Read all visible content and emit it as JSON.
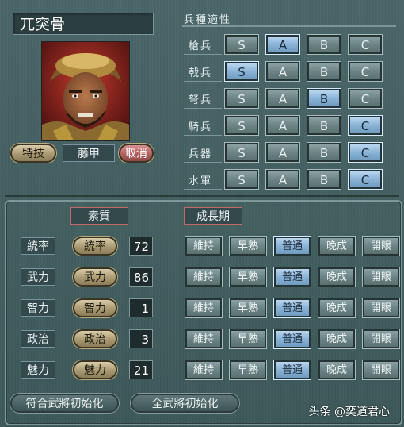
{
  "general": {
    "name": "兀突骨",
    "tech_label": "特技",
    "tech_value": "藤甲",
    "cancel_label": "取消"
  },
  "aptitude": {
    "title": "兵種適性",
    "grades": [
      "S",
      "A",
      "B",
      "C"
    ],
    "rows": [
      {
        "label": "槍兵",
        "selected": "A"
      },
      {
        "label": "戟兵",
        "selected": "S"
      },
      {
        "label": "弩兵",
        "selected": "B"
      },
      {
        "label": "騎兵",
        "selected": "C"
      },
      {
        "label": "兵器",
        "selected": "C"
      },
      {
        "label": "水軍",
        "selected": "C"
      }
    ]
  },
  "stats": {
    "quality_header": "素質",
    "growth_header": "成長期",
    "growth_options": [
      "維持",
      "早熟",
      "普通",
      "晚成",
      "開眼"
    ],
    "rows": [
      {
        "label": "統率",
        "button": "統率",
        "value": "72",
        "growth": "普通"
      },
      {
        "label": "武力",
        "button": "武力",
        "value": "86",
        "growth": "普通"
      },
      {
        "label": "智力",
        "button": "智力",
        "value": "1",
        "growth": "普通"
      },
      {
        "label": "政治",
        "button": "政治",
        "value": "3",
        "growth": "普通"
      },
      {
        "label": "魅力",
        "button": "魅力",
        "value": "21",
        "growth": "普通"
      }
    ]
  },
  "footer": {
    "reset_matching": "符合武將初始化",
    "reset_all": "全武將初始化"
  },
  "watermark": "头条 @奕道君心"
}
